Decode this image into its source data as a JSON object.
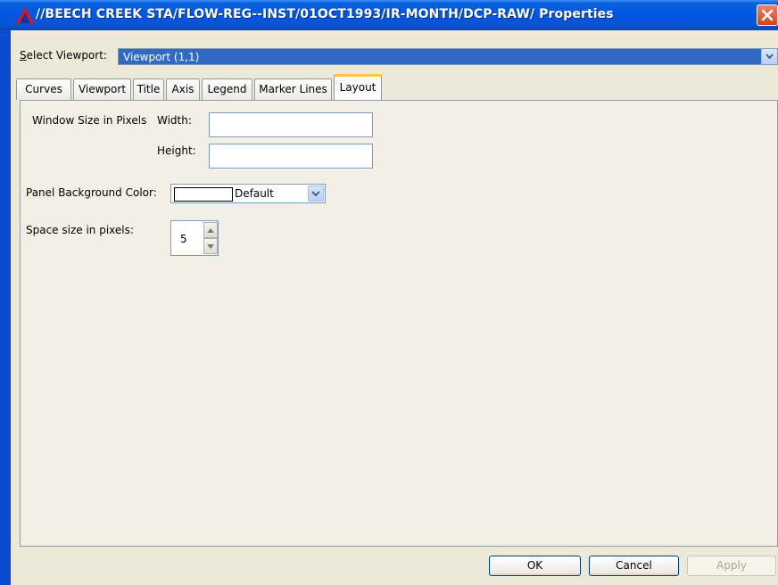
{
  "window": {
    "title": "//BEECH CREEK STA/FLOW-REG--INST/01OCT1993/IR-MONTH/DCP-RAW/ Properties",
    "close_icon": "close-icon",
    "app_icon": "app-triangle-icon"
  },
  "viewport_selector": {
    "label_prefix": "S",
    "label_rest": "elect Viewport:",
    "value": "Viewport (1,1)"
  },
  "tabs": [
    {
      "label": "Curves"
    },
    {
      "label": "Viewport"
    },
    {
      "label": "Title"
    },
    {
      "label": "Axis"
    },
    {
      "label": "Legend"
    },
    {
      "label": "Marker Lines"
    },
    {
      "label": "Layout",
      "active": true
    }
  ],
  "layout": {
    "window_size_label": "Window Size in Pixels",
    "width_label": "Width:",
    "width_value": "",
    "height_label": "Height:",
    "height_value": "",
    "bg_color_label": "Panel Background Color:",
    "bg_color_value": "Default",
    "bg_color_swatch": "#ffffff",
    "space_label": "Space size in pixels:",
    "space_value": "5"
  },
  "buttons": {
    "ok": "OK",
    "cancel": "Cancel",
    "apply": "Apply"
  },
  "colors": {
    "titlebar": "#0058e6",
    "selection": "#316ac5",
    "active_tab_accent": "#ffc83c",
    "dialog_bg": "#ece9d8"
  }
}
